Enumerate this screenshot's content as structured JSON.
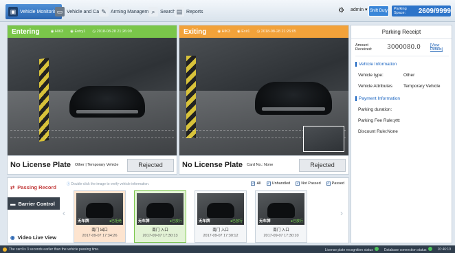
{
  "nav": [
    {
      "label": "Vehicle Monitoring",
      "icon": "monitor-icon"
    },
    {
      "label": "Vehicle and Card",
      "icon": "car-card-icon"
    },
    {
      "label": "Arming Management",
      "icon": "arming-icon"
    },
    {
      "label": "Search",
      "icon": "search-icon"
    },
    {
      "label": "Reports",
      "icon": "reports-icon"
    }
  ],
  "header": {
    "user": "admin",
    "shift_button": "Shift Duty",
    "parking_space_label": "Parking Space:",
    "parking_space_value": "2609/9999"
  },
  "entering": {
    "title": "Entering",
    "camera": "HIK3",
    "lane": "Entry1",
    "time": "2018-08-28 21:26:09",
    "plate": "No License Plate",
    "info": "Other | Temporary Vehicle",
    "action": "Rejected",
    "color": "#7ac64a"
  },
  "exiting": {
    "title": "Exiting",
    "camera": "HIK3",
    "lane": "Exit1",
    "time": "2018-08-28 21:26:05",
    "plate": "No License Plate",
    "info": "Card No.: None",
    "action": "Rejected",
    "color": "#f2a23a"
  },
  "receipt": {
    "title": "Parking Receipt",
    "amount_label": "Amount Received:",
    "amount_value": "3000080.0",
    "view_details": "[View Details]",
    "vehicle_section": "Vehicle Information",
    "vehicle_type_label": "Vehicle type:",
    "vehicle_type_value": "Other",
    "vehicle_attr_label": "Vehicle Attributes",
    "vehicle_attr_value": "Temporary Vehicle",
    "payment_section": "Payment Information",
    "parking_duration": "Parking duration:",
    "fee_rule": "Parking Fee Rule:yttt",
    "discount_rule": "Discount Rule:None"
  },
  "bottom": {
    "tab_passing": "Passing Record",
    "tab_barrier": "Barrier Control",
    "tab_live": "Video Live View",
    "hint": "Double-click the image to verify vehicle information.",
    "filters": [
      {
        "label": "All",
        "checked": true
      },
      {
        "label": "Unhandled",
        "checked": true
      },
      {
        "label": "Not Passed",
        "checked": true
      },
      {
        "label": "Passed",
        "checked": true
      }
    ],
    "records": [
      {
        "plate": "无车牌",
        "tag": "●已拒绝",
        "gate": "南门 出口",
        "time": "2017-09-07 17:34:26",
        "bg": "#fde4cf"
      },
      {
        "plate": "无车牌",
        "tag": "●已放行",
        "gate": "南门 入口",
        "time": "2017-09-07 17:30:13",
        "bg": "#e3f3d6"
      },
      {
        "plate": "无车牌",
        "tag": "●已放行",
        "gate": "南门 入口",
        "time": "2017-09-07 17:30:12",
        "bg": "#f4f6f8"
      },
      {
        "plate": "无车牌",
        "tag": "●已放行",
        "gate": "南门 入口",
        "time": "2017-09-07 17:30:10",
        "bg": "#f4f6f8"
      }
    ]
  },
  "status": {
    "message": "The card is 3 seconds earlier than the vehicle passing time.",
    "lpr_label": "License plate recognition status",
    "db_label": "Database connection status",
    "clock": "10:46:19"
  }
}
